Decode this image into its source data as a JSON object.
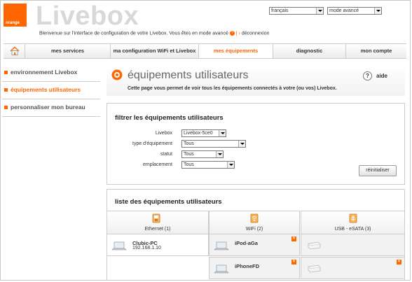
{
  "header": {
    "logo_text": "orange",
    "brand": "Livebox",
    "welcome": "Bienvenue sur l'interface de configuration de votre Livebox. Vous êtes en mode avancé",
    "separator": "|",
    "logout": "déconnexion",
    "language_select": "français",
    "mode_select": "mode avancé"
  },
  "nav": {
    "tabs": [
      "mes services",
      "ma configuration WiFi et Livebox",
      "mes équipements",
      "diagnostic",
      "mon compte"
    ]
  },
  "sidebar": {
    "items": [
      "environnement Livebox",
      "équipements utilisateurs",
      "personnaliser mon bureau"
    ]
  },
  "page": {
    "title": "équipements utilisateurs",
    "subtitle": "Cette page vous permet de voir tous les équipements connectés à votre (ou vos) Livebox.",
    "help_symbol": "?",
    "help": "aide"
  },
  "filter": {
    "heading": "filtrer les équipements utilisateurs",
    "livebox_label": "Livebox",
    "livebox_value": "Livebox-5ce0",
    "type_label": "type d'équipement",
    "type_value": "Tous",
    "status_label": "statut",
    "status_value": "Tous",
    "location_label": "emplacement",
    "location_value": "Tous",
    "reset": "réinitialiser"
  },
  "list": {
    "heading": "liste des équipements utilisateurs",
    "columns": [
      {
        "title": "Ethernet (1)",
        "icon": "ethernet-icon"
      },
      {
        "title": "WiFi (2)",
        "icon": "wifi-icon"
      },
      {
        "title": "USB - eSATA (3)",
        "icon": "usb-icon"
      }
    ],
    "ethernet": [
      {
        "name": "Clubic-PC",
        "ip": "192.168.1.10"
      }
    ],
    "wifi": [
      {
        "name": "iPod-aGa"
      },
      {
        "name": "iPhoneFD"
      }
    ]
  },
  "colors": {
    "accent": "#ff6600"
  }
}
